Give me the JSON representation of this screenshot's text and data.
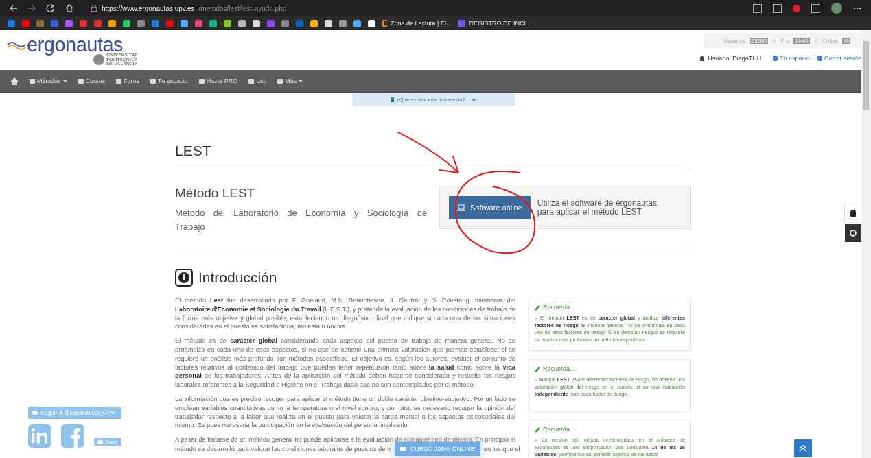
{
  "browser": {
    "url_host": "https://www.ergonautas.upv.es",
    "url_path": "/metodos/lest/lest-ayuda.php",
    "bookmarks": [
      "Zona de Lectura | El...",
      "REGISTRO DE INCI..."
    ]
  },
  "header": {
    "logo": "ergonautas",
    "university": [
      "UNIVERSITAT",
      "POLITÈCNICA",
      "DE VALÈNCIA"
    ],
    "stats": [
      {
        "label": "Usuarios:",
        "value": "200300"
      },
      {
        "label": "Pro:",
        "value": "19400"
      },
      {
        "label": "Online:",
        "value": "96"
      }
    ],
    "stat_separator": "/",
    "user": "Usuario: DiegoTHH",
    "links": [
      "Tu espacio",
      "Cerrar sesión"
    ]
  },
  "nav": [
    {
      "label": "Métodos",
      "dropdown": true
    },
    {
      "label": "Cursos",
      "dropdown": false
    },
    {
      "label": "Foros",
      "dropdown": false
    },
    {
      "label": "Tu espacio",
      "dropdown": false
    },
    {
      "label": "Hazte PRO",
      "dropdown": false
    },
    {
      "label": "Lab",
      "dropdown": false
    },
    {
      "label": "Más",
      "dropdown": true
    }
  ],
  "cite_tab": "¿Quieres citar este documento?",
  "title": "LEST",
  "method": {
    "name": "Método LEST",
    "subtitle": "Método del Laboratorio de Economía y Sociología del Trabajo",
    "button": "Software online",
    "description": "Utiliza el software de ergonautas para aplicar el método LEST"
  },
  "intro": {
    "heading": "Introducción",
    "paragraphs": [
      "El método **Lest** fue desarrollado por F. Guélaud, M.N. Beauchesne, J. Gautrat y G. Roustang, miembros del **Laboratoire d'Economie et Sociologie du Travail** (L.E.S.T.), y pretende la evaluación de las condiciones de trabajo de la forma más objetiva y global posible, estableciendo un diagnóstico final que indique si cada una de las situaciones consideradas en el puesto es satisfactoria, molesta o nociva.",
      "El método es de **carácter global** considerando cada aspecto del puesto de trabajo de manera general. No se profundiza en cada uno de esos aspectos, si no que se obtiene una primera valoración que permite establecer si se requiere un análisis más profundo con métodos específicos. El objetivo es, según los autores, evaluar el conjunto de factores relativos al contenido del trabajo que pueden tener repercusión tanto sobre **la salud** como sobre la **vida personal** de los trabajadores. Antes de la aplicación del método deben haberse considerado y resuelto los riesgos laborales referentes a la Seguridad e Higiene en el Trabajo dado que no son contemplados por el método.",
      "La información que es preciso recoger para aplicar el método tiene un doble carácter objetivo-subjetivo. Por un lado se emplean variables cuantitativas como la temperatura o el nivel sonoro, y por otra, es necesario recoger la opinión del trabajador respecto a la labor que realiza en el puesto para valorar la carga mental o los aspectos psicosociales del mismo. Es pues necesaria la participación en la evaluación del personal implicado",
      "A pesar de tratarse de un método general no puede aplicarse a la evaluación de cualquier tipo de puesto. En principio el",
      "método se desarrolló para valorar las condiciones laborales de puestos de tr"
    ]
  },
  "notes": [
    {
      "title": "Recuerda...",
      "text": "– El método **LEST** es de **carácter global** y analiza **diferentes factores de riesgo** de manera general. No se profundiza en cada uno de esos factores de riesgo. Si se detectan riesgos se requiere un análisis más profundo con métodos específicos."
    },
    {
      "title": "Recuerda...",
      "text": "– Aunque **LEST** valore diferentes factores de riesgo, no obtiene una valoración global del riesgo en el puesto, si no una valoración **independiente** para cada factor de riesgo."
    },
    {
      "title": "Recuerda...",
      "text": "– La versión del método implementada en el software de Ergonautas es una simplificación que considera **14 de las 16 variables**, permitiendo así eliminar algunos de los datos"
    }
  ],
  "social": {
    "follow": "Seguir a @Ergonautas_UPV",
    "tweet": "Tweet"
  },
  "course_button": "CURSO 100% ONLINE",
  "course_after_text": "en los que el"
}
